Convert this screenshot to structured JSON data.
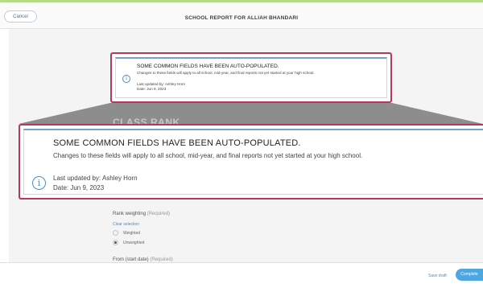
{
  "header": {
    "cancel_label": "Cancel",
    "title": "SCHOOL REPORT FOR ALLIAH BHANDARI"
  },
  "notice": {
    "title": "SOME COMMON FIELDS HAVE BEEN AUTO-POPULATED.",
    "description": "Changes to these fields will apply to all school, mid-year, and final reports not yet started at your high school.",
    "updated_by": "Last updated by: Ashley Horn",
    "date": "Date: Jun 9, 2023",
    "icon": "info-icon"
  },
  "section_heading": "CLASS RANK",
  "rank_weighting": {
    "label": "Rank weighting",
    "required": "(Required)",
    "clear_selection": "Clear selection",
    "options": [
      {
        "label": "Weighted",
        "selected": false
      },
      {
        "label": "Unweighted",
        "selected": true
      }
    ]
  },
  "from_start_date": {
    "label": "From (start date)",
    "required": "(Required)"
  },
  "footer": {
    "save_draft_label": "Save draft",
    "complete_label": "Complete"
  },
  "colors": {
    "highlight_border": "#b23a5c",
    "accent_blue": "#4fa7e0",
    "top_stripe": "#b7dc88"
  }
}
